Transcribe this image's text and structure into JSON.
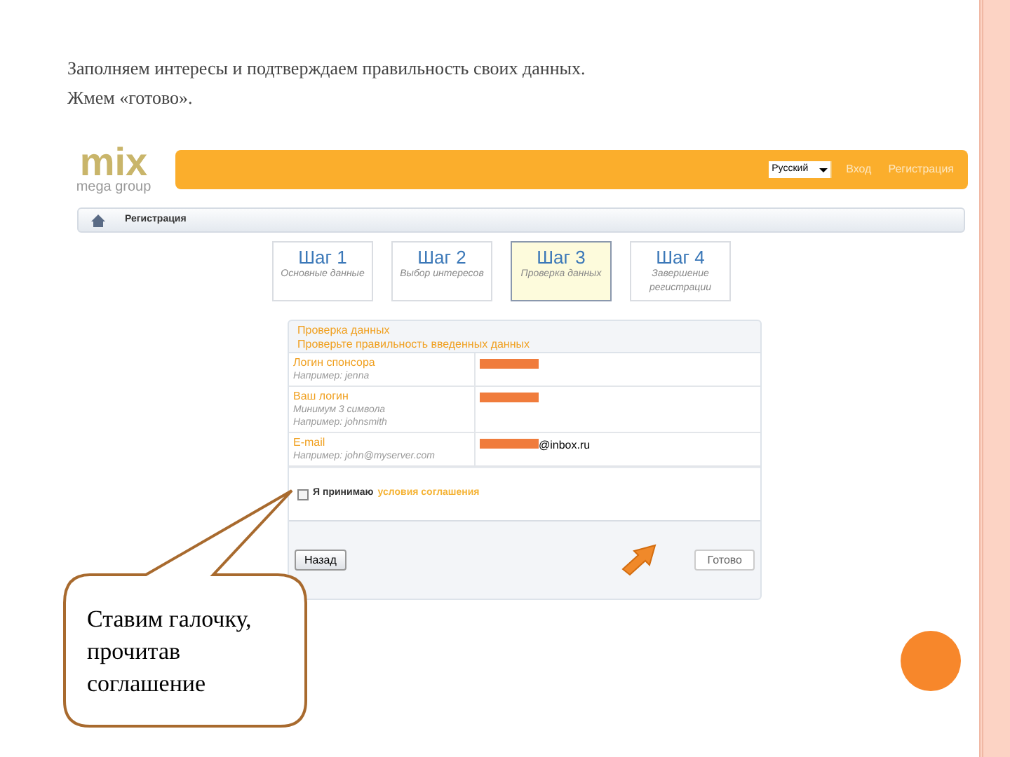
{
  "slide": {
    "title": "Заполняем интересы и подтверждаем правильность своих данных.",
    "title_line2": "Жмем «готово».",
    "callout": "Ставим галочку, прочитав соглашение"
  },
  "site": {
    "logo": {
      "word": "mix",
      "tagline": "mega group"
    },
    "language": "Русский",
    "nav": [
      "Вход",
      "Регистрация"
    ],
    "breadcrumb": "Регистрация",
    "steps": [
      {
        "title": "Шаг 1",
        "subtitle": "Основные данные",
        "selected": false
      },
      {
        "title": "Шаг 2",
        "subtitle": "Выбор интересов",
        "selected": false
      },
      {
        "title": "Шаг 3",
        "subtitle": "Проверка данных",
        "selected": true
      },
      {
        "title": "Шаг 4",
        "subtitle": "Завершение регистрации",
        "selected": false
      }
    ],
    "form": {
      "title": "Проверка данных",
      "subtitle": "Проверьте правильность введенных данных",
      "fields": [
        {
          "label": "Логин спонсора",
          "hints": [
            "Например: jenna"
          ],
          "redacted": true
        },
        {
          "label": "Ваш логин",
          "hints": [
            "Минимум 3 символа",
            "Например: johnsmith"
          ],
          "redacted": true
        },
        {
          "label": "E-mail",
          "hints": [
            "Например: john@myserver.com"
          ],
          "redacted": true,
          "value": "@inbox.ru"
        }
      ],
      "agreement": {
        "checked": false,
        "text": "Я принимаю",
        "link": "условия соглашения"
      },
      "back_button": "Назад",
      "done_button": "Готово"
    }
  }
}
